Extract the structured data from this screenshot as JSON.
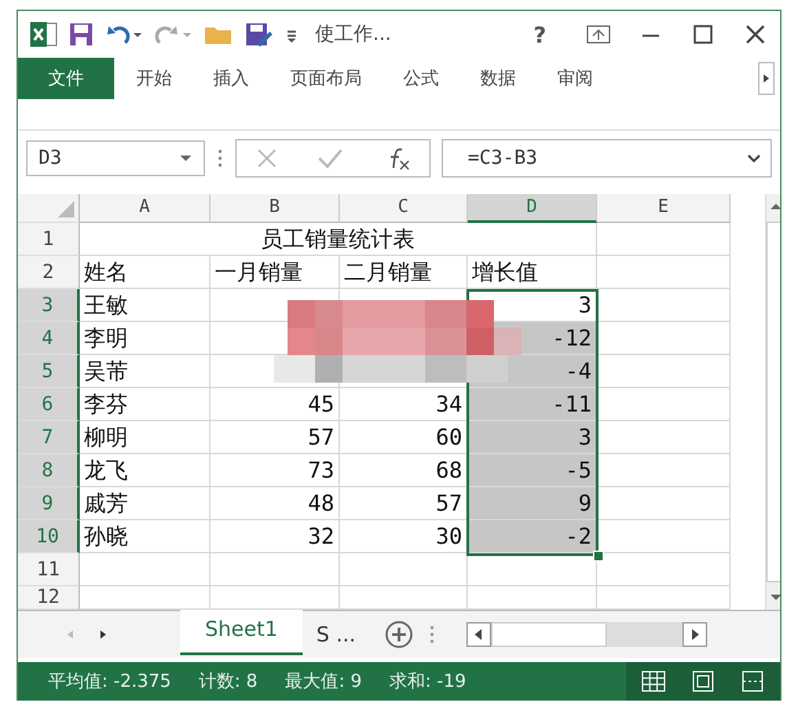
{
  "title_bar": {
    "title": "使工作...",
    "help": "?"
  },
  "ribbon_tabs": [
    {
      "label": "文件",
      "selected": true
    },
    {
      "label": "开始",
      "selected": false
    },
    {
      "label": "插入",
      "selected": false
    },
    {
      "label": "页面布局",
      "selected": false
    },
    {
      "label": "公式",
      "selected": false
    },
    {
      "label": "数据",
      "selected": false
    },
    {
      "label": "审阅",
      "selected": false
    }
  ],
  "name_box": "D3",
  "formula": "=C3-B3",
  "columns": [
    {
      "label": "A",
      "selected": false
    },
    {
      "label": "B",
      "selected": false
    },
    {
      "label": "C",
      "selected": false
    },
    {
      "label": "D",
      "selected": true
    },
    {
      "label": "E",
      "selected": false
    }
  ],
  "rows": [
    {
      "number": "1",
      "selected": false,
      "title": "员工销量统计表"
    },
    {
      "number": "2",
      "selected": false,
      "cells": [
        "姓名",
        "一月销量",
        "二月销量",
        "增长值"
      ]
    },
    {
      "number": "3",
      "selected": true,
      "cells": [
        "王敏",
        "",
        "",
        "3"
      ],
      "active": true
    },
    {
      "number": "4",
      "selected": true,
      "cells": [
        "李明",
        "",
        "",
        "-12"
      ],
      "active": false
    },
    {
      "number": "5",
      "selected": true,
      "cells": [
        "吴芾",
        "",
        "",
        "-4"
      ],
      "active": false
    },
    {
      "number": "6",
      "selected": true,
      "cells": [
        "李芬",
        "45",
        "34",
        "-11"
      ],
      "active": false
    },
    {
      "number": "7",
      "selected": true,
      "cells": [
        "柳明",
        "57",
        "60",
        "3"
      ],
      "active": false
    },
    {
      "number": "8",
      "selected": true,
      "cells": [
        "龙飞",
        "73",
        "68",
        "-5"
      ],
      "active": false
    },
    {
      "number": "9",
      "selected": true,
      "cells": [
        "戚芳",
        "48",
        "57",
        "9"
      ],
      "active": false
    },
    {
      "number": "10",
      "selected": true,
      "cells": [
        "孙晓",
        "32",
        "30",
        "-2"
      ],
      "active": false
    },
    {
      "number": "11",
      "selected": false,
      "cells": []
    },
    {
      "number": "12",
      "selected": false,
      "cells": []
    }
  ],
  "sheet_tabs": [
    {
      "label": "Sheet1",
      "selected": true
    },
    {
      "label": "S ...",
      "selected": false
    }
  ],
  "status_bar": [
    "平均值: -2.375",
    "计数: 8",
    "最大值: 9",
    "求和: -19"
  ]
}
